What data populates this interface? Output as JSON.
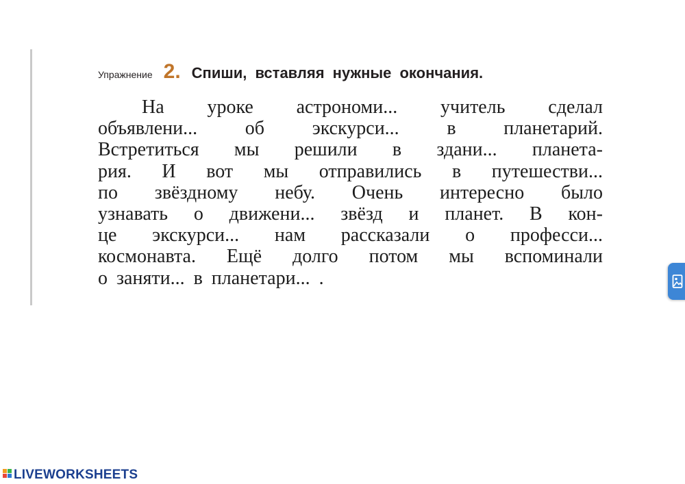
{
  "exercise": {
    "word": "Упражнение",
    "number": "2.",
    "task": "Спиши, вставляя нужные окончания."
  },
  "text_lines": [
    "На уроке астрономи... учитель сделал",
    "объявлени... об экскурси... в планетарий.",
    "Встретиться мы решили в здани... планета-",
    "рия. И вот мы отправились в путешестви...",
    "по звёздному небу. Очень интересно было",
    "узнавать о движени... звёзд и планет. В кон-",
    "це экскурси... нам рассказали о професси...",
    "космонавта. Ещё долго потом мы вспоминали",
    "о заняти... в планетари... ."
  ],
  "side_tab": {
    "icon": "image-icon"
  },
  "brand": {
    "name": "LIVEWORKSHEETS",
    "icon": "liveworksheets-logo-icon"
  },
  "colors": {
    "exercise_number": "#c0752a",
    "side_tab": "#3d86d6",
    "brand_text": "#1b3f8f",
    "left_rule": "#c9c9c9"
  }
}
